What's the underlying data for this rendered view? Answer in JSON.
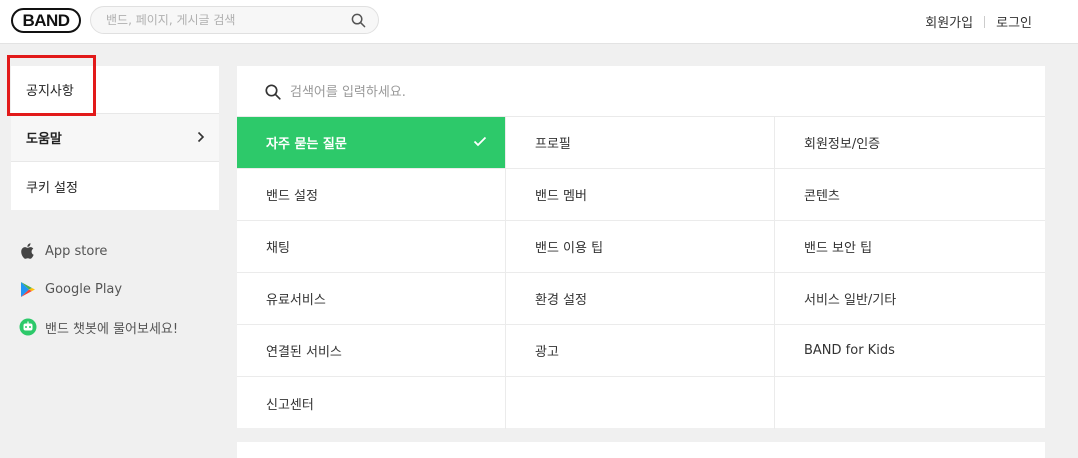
{
  "header": {
    "logo_text": "BAND",
    "search_placeholder": "밴드, 페이지, 게시글 검색",
    "signup_label": "회원가입",
    "login_label": "로그인"
  },
  "left_menu": {
    "items": [
      {
        "label": "공지사항"
      },
      {
        "label": "도움말"
      },
      {
        "label": "쿠키 설정"
      }
    ]
  },
  "app_links": [
    {
      "label": "App store",
      "icon": "apple-icon"
    },
    {
      "label": "Google Play",
      "icon": "google-play-icon"
    },
    {
      "label": "밴드 챗봇에 물어보세요!",
      "icon": "chatbot-icon"
    }
  ],
  "main": {
    "search_placeholder": "검색어를 입력하세요.",
    "categories": [
      {
        "label": "자주 묻는 질문",
        "active": true
      },
      {
        "label": "프로필"
      },
      {
        "label": "회원정보/인증"
      },
      {
        "label": "밴드 설정"
      },
      {
        "label": "밴드 멤버"
      },
      {
        "label": "콘텐츠"
      },
      {
        "label": "채팅"
      },
      {
        "label": "밴드 이용 팁"
      },
      {
        "label": "밴드 보안 팁"
      },
      {
        "label": "유료서비스"
      },
      {
        "label": "환경 설정"
      },
      {
        "label": "서비스 일반/기타"
      },
      {
        "label": "연결된 서비스"
      },
      {
        "label": "광고"
      },
      {
        "label": "BAND for Kids"
      },
      {
        "label": "신고센터"
      },
      {
        "label": ""
      },
      {
        "label": ""
      }
    ]
  },
  "colors": {
    "accent_green": "#2dc96a",
    "highlight_red": "#e21a1a"
  }
}
